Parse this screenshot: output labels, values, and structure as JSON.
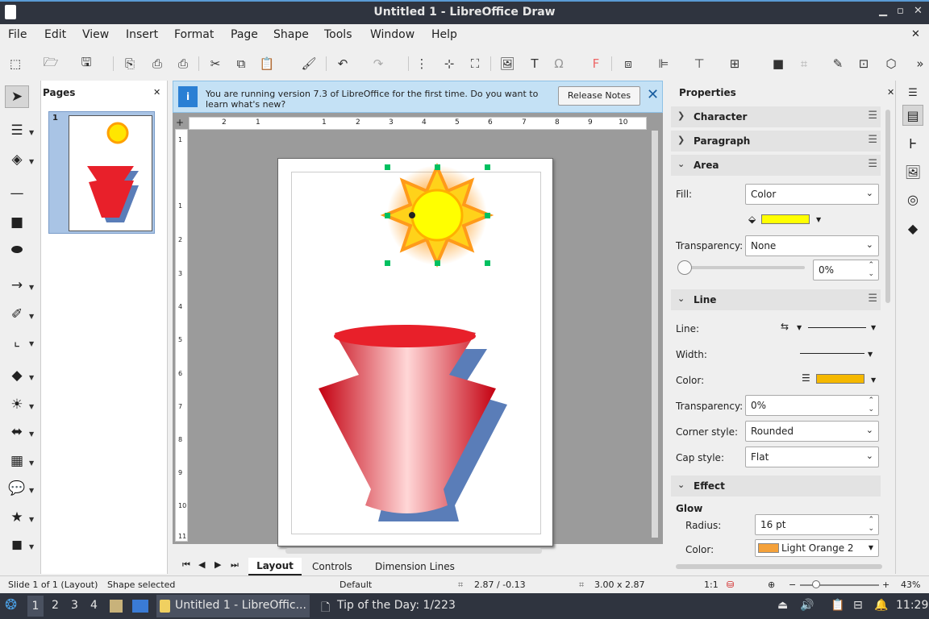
{
  "window": {
    "title": "Untitled 1 - LibreOffice Draw"
  },
  "menu": [
    "File",
    "Edit",
    "View",
    "Insert",
    "Format",
    "Page",
    "Shape",
    "Tools",
    "Window",
    "Help"
  ],
  "pages_panel": {
    "title": "Pages",
    "page_number": "1"
  },
  "infobar": {
    "message_line1": "You are running version 7.3 of LibreOffice for the first time. Do you want to",
    "message_line2": "learn what's new?",
    "button": "Release Notes"
  },
  "ruler": {
    "h": [
      "2",
      "1",
      "1",
      "2",
      "3",
      "4",
      "5",
      "6",
      "7",
      "8",
      "9",
      "10"
    ],
    "v": [
      "1",
      "1",
      "2",
      "3",
      "4",
      "5",
      "6",
      "7",
      "8",
      "9",
      "10",
      "11"
    ]
  },
  "tabs": [
    "Layout",
    "Controls",
    "Dimension Lines"
  ],
  "properties": {
    "title": "Properties",
    "sections": {
      "character": "Character",
      "paragraph": "Paragraph",
      "area": "Area",
      "line": "Line",
      "effect": "Effect"
    },
    "area": {
      "fill_label": "Fill:",
      "fill_value": "Color",
      "fill_color": "#ffff00",
      "transparency_label": "Transparency:",
      "transparency_value": "None",
      "transparency_pct": "0%"
    },
    "line": {
      "line_label": "Line:",
      "width_label": "Width:",
      "color_label": "Color:",
      "line_color": "#f5b800",
      "transparency_label": "Transparency:",
      "transparency_value": "0%",
      "corner_label": "Corner style:",
      "corner_value": "Rounded",
      "cap_label": "Cap style:",
      "cap_value": "Flat"
    },
    "effect": {
      "glow_label": "Glow",
      "radius_label": "Radius:",
      "radius_value": "16 pt",
      "color_label": "Color:",
      "color_value": "Light Orange 2",
      "glow_color": "#f4a13a"
    }
  },
  "status": {
    "slide": "Slide 1 of 1 (Layout)",
    "selection": "Shape selected",
    "style": "Default",
    "position": "2.87 / -0.13",
    "size": "3.00 x 2.87",
    "scale": "1:1",
    "zoom": "43%"
  },
  "taskbar": {
    "ws1": "1",
    "ws2": "2",
    "ws3": "3",
    "ws4": "4",
    "app1": "Untitled 1 - LibreOffic...",
    "app2": "Tip of the Day: 1/223",
    "clock": "11:29"
  }
}
